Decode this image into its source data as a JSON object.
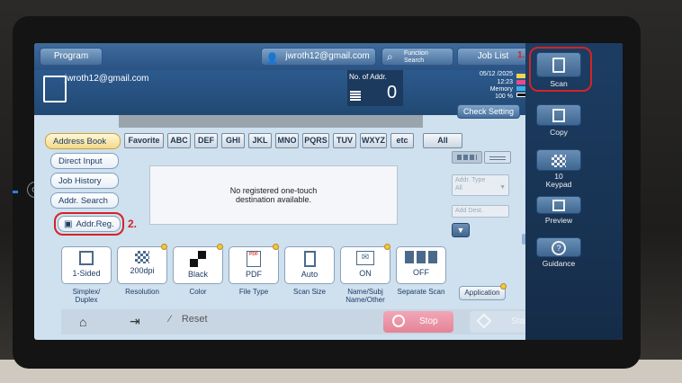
{
  "top": {
    "program": "Program",
    "user_email": "jwroth12@gmail.com",
    "function_search": "Function\nSearch",
    "job_list": "Job List"
  },
  "header": {
    "email": "jwroth12@gmail.com",
    "no_of_addr_label": "No. of Addr.",
    "no_of_addr_value": "0",
    "date": "05/12 /2025",
    "time": "12:23",
    "memory_label": "Memory",
    "memory_value": "100 %",
    "check_setting": "Check Setting"
  },
  "left_tabs": [
    "Address Book",
    "Direct Input",
    "Job History",
    "Addr. Search"
  ],
  "addr_reg": "Addr.Reg.",
  "letters": [
    "Favorite",
    "ABC",
    "DEF",
    "GHI",
    "JKL",
    "MNO",
    "PQRS",
    "TUV",
    "WXYZ",
    "etc",
    "All"
  ],
  "empty_msg": "No registered one-touch\ndestination available.",
  "addr_type_label": "Addr. Type",
  "addr_type_value": "All",
  "add_dest": "Add Dest.",
  "functions": [
    {
      "value": "1-Sided",
      "label": "Simplex/\nDuplex"
    },
    {
      "value": "200dpi",
      "label": "Resolution"
    },
    {
      "value": "Black",
      "label": "Color"
    },
    {
      "value": "PDF",
      "label": "File Type"
    },
    {
      "value": "Auto",
      "label": "Scan Size"
    },
    {
      "value": "ON",
      "label": "Name/Subj\nName/Other"
    },
    {
      "value": "OFF",
      "label": "Separate Scan"
    }
  ],
  "application": "Application",
  "bottom": {
    "reset": "Reset",
    "stop": "Stop",
    "start": "Start"
  },
  "side": {
    "scan": "Scan",
    "copy": "Copy",
    "keypad_top": "10",
    "keypad": "Keypad",
    "preview": "Preview",
    "guidance": "Guidance"
  },
  "annotations": {
    "one": "1.",
    "two": "2."
  },
  "colors": {
    "accent_red": "#d42424",
    "screen_blue": "#2c5a8e",
    "active_tab": "#f3d98a"
  }
}
